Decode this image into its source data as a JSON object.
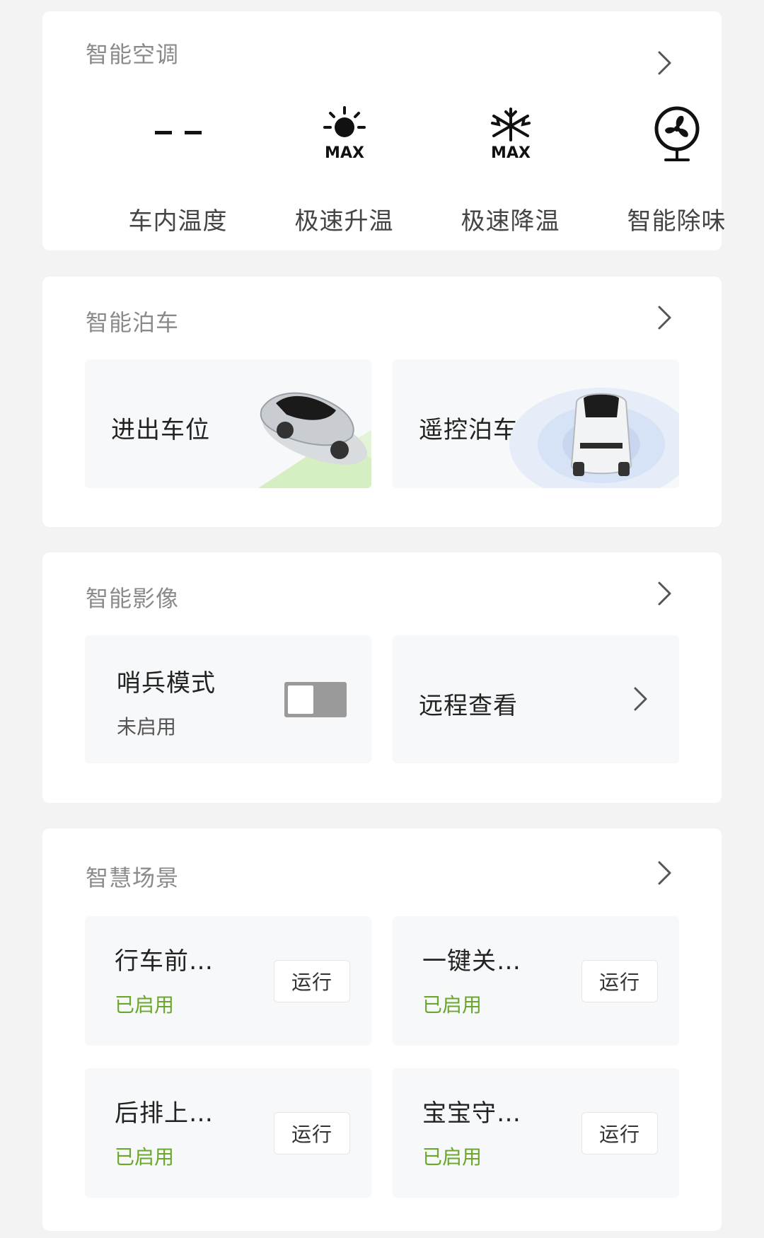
{
  "climate": {
    "title": "智能空调",
    "items": [
      {
        "label": "车内温度",
        "icon": "temperature-dashes-icon"
      },
      {
        "label": "极速升温",
        "icon": "sun-max-icon",
        "badge": "MAX"
      },
      {
        "label": "极速降温",
        "icon": "snowflake-max-icon",
        "badge": "MAX"
      },
      {
        "label": "智能除味",
        "icon": "fan-icon"
      }
    ]
  },
  "parking": {
    "title": "智能泊车",
    "tiles": [
      {
        "label": "进出车位"
      },
      {
        "label": "遥控泊车"
      }
    ]
  },
  "imaging": {
    "title": "智能影像",
    "sentry": {
      "label": "哨兵模式",
      "status": "未启用",
      "enabled": false
    },
    "remote": {
      "label": "远程查看"
    }
  },
  "scenes": {
    "title": "智慧场景",
    "items": [
      {
        "label": "行车前…",
        "status": "已启用",
        "button": "运行"
      },
      {
        "label": "一键关…",
        "status": "已启用",
        "button": "运行"
      },
      {
        "label": "后排上…",
        "status": "已启用",
        "button": "运行"
      },
      {
        "label": "宝宝守…",
        "status": "已启用",
        "button": "运行"
      }
    ]
  },
  "colors": {
    "background": "#f3f3f3",
    "card": "#ffffff",
    "tile": "#f7f8f9",
    "enabled_green": "#6aa72a",
    "toggle_off": "#9a9a9a"
  }
}
